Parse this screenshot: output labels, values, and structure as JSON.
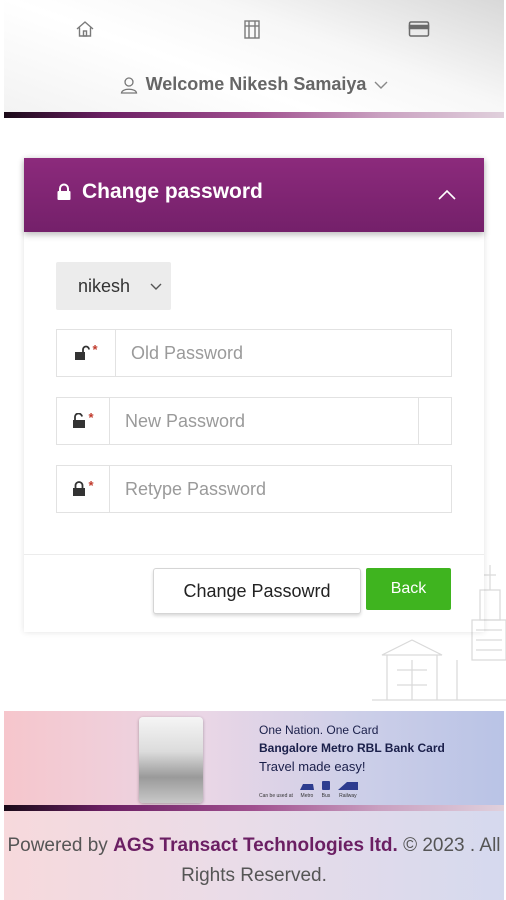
{
  "header": {
    "icons": [
      "home-icon",
      "building-icon",
      "card-icon"
    ],
    "welcome_text": "Welcome Nikesh Samaiya"
  },
  "change_password": {
    "title": "Change password",
    "username": "nikesh",
    "old_password_placeholder": "Old Password",
    "new_password_placeholder": "New Password",
    "retype_password_placeholder": "Retype Password",
    "required_marker": "*",
    "submit_label": "Change Passowrd",
    "back_label": "Back"
  },
  "banner": {
    "line1": "One Nation. One Card",
    "line2": "Bangalore Metro RBL Bank Card",
    "line3": "Travel made easy!",
    "usage_caption": "Can be used at",
    "modes": [
      "Metro",
      "Bus",
      "Railway"
    ]
  },
  "footer": {
    "prefix": "Powered by",
    "company": "AGS Transact Technologies ltd.",
    "suffix": "© 2023 . All Rights Reserved."
  },
  "colors": {
    "accent": "#7a236f",
    "back_button": "#3fb41f",
    "required": "#c0392b"
  }
}
